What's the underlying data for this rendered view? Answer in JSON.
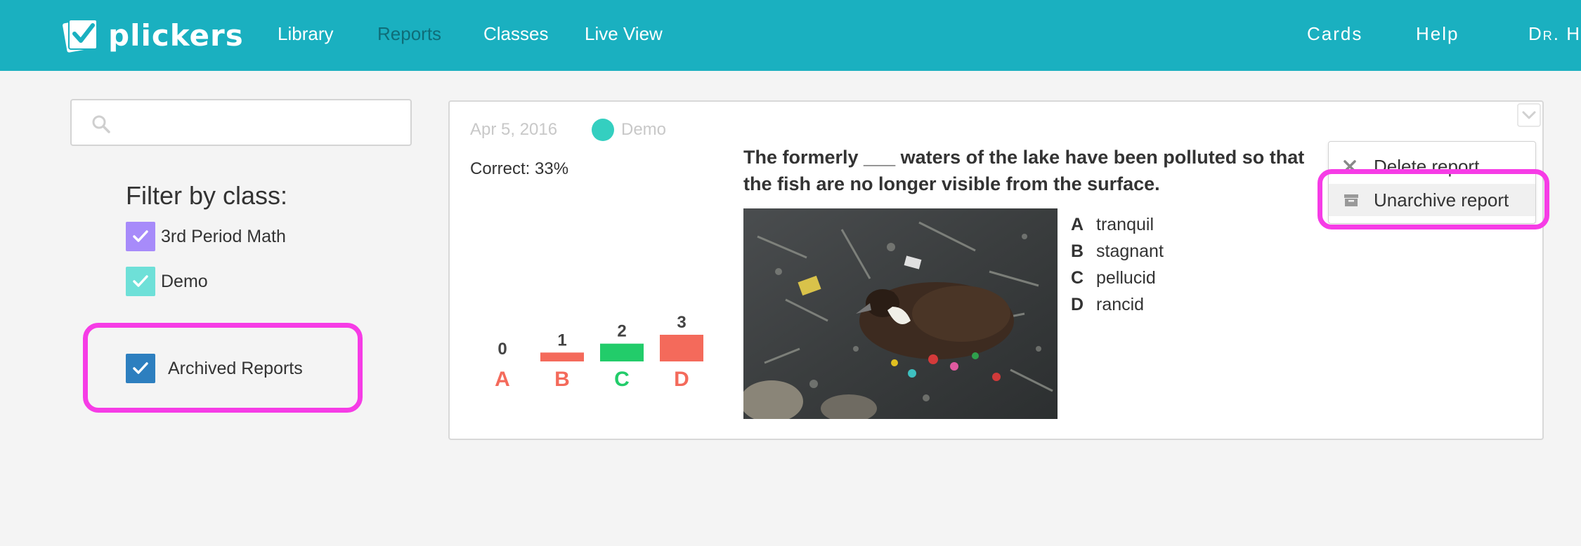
{
  "app": {
    "logo_text": "plickers"
  },
  "nav": {
    "items": [
      {
        "label": "Library"
      },
      {
        "label": "Reports"
      },
      {
        "label": "Classes"
      },
      {
        "label": "Live View"
      }
    ],
    "right": [
      {
        "label": "Cards"
      },
      {
        "label": "Help"
      },
      {
        "label": "Dr. Ha"
      }
    ]
  },
  "sidebar": {
    "search": {
      "value": "",
      "placeholder": ""
    },
    "filter_title": "Filter by class:",
    "classes": [
      {
        "label": "3rd Period Math",
        "color": "#a78bfa",
        "checked": true
      },
      {
        "label": "Demo",
        "color": "#6ee0d8",
        "checked": true
      }
    ],
    "archived": {
      "label": "Archived Reports",
      "checked": true,
      "color": "#2d7fbf"
    }
  },
  "report": {
    "date": "Apr 5, 2016",
    "class_name": "Demo",
    "class_color": "#34cfc0",
    "correct": "Correct: 33%",
    "question": "The formerly ___ waters of the lake have been polluted so that the fish are no longer visible from the surface.",
    "answers": [
      {
        "letter": "A",
        "text": "tranquil"
      },
      {
        "letter": "B",
        "text": "stagnant"
      },
      {
        "letter": "C",
        "text": "pellucid"
      },
      {
        "letter": "D",
        "text": "rancid"
      }
    ],
    "menu": {
      "delete_label": "Delete report",
      "unarchive_label": "Unarchive report"
    }
  },
  "chart_data": {
    "type": "bar",
    "categories": [
      "A",
      "B",
      "C",
      "D"
    ],
    "values": [
      0,
      1,
      2,
      3
    ],
    "colors": [
      "#f46a5b",
      "#f46a5b",
      "#22cc6a",
      "#f46a5b"
    ],
    "ylim": [
      0,
      3
    ]
  },
  "colors": {
    "topbar": "#1ab0c0",
    "highlight": "#f63ce6",
    "incorrect": "#f46a5b",
    "correct": "#22cc6a"
  }
}
